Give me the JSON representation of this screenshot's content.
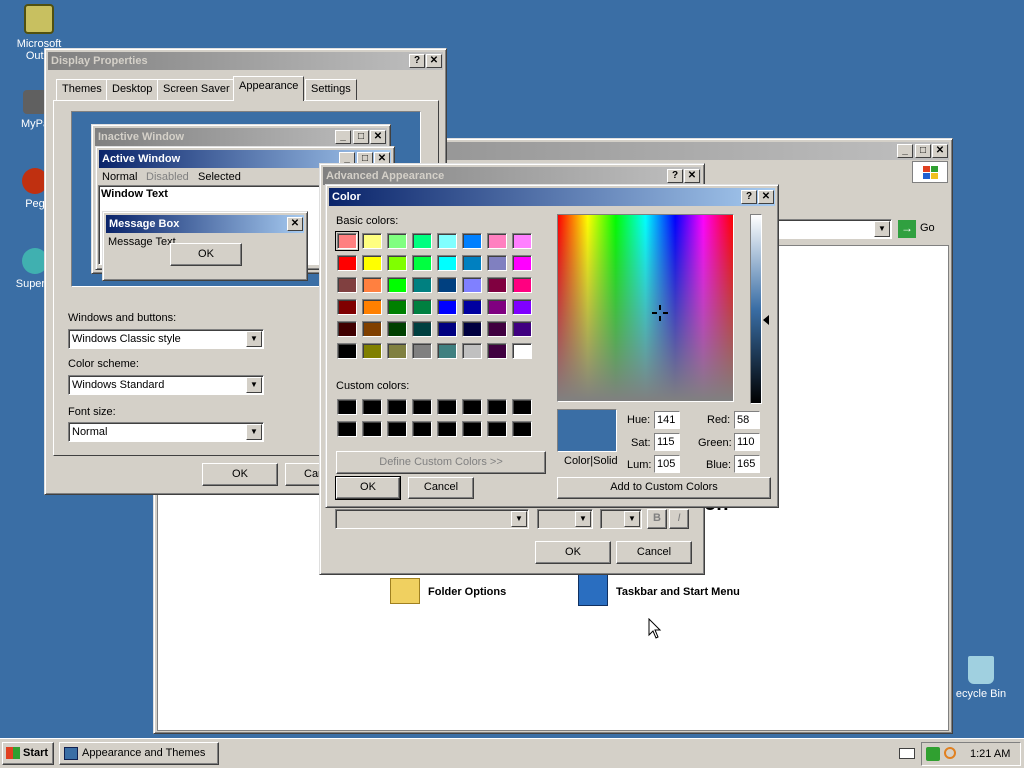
{
  "desktop": {
    "icons": [
      {
        "label": "Microsoft Outlo",
        "icon": "outlook-icon"
      },
      {
        "label": "MyPa",
        "icon": "my-pictures-icon"
      },
      {
        "label": "Peg",
        "icon": "app-icon"
      },
      {
        "label": "Superm",
        "icon": "app-icon"
      },
      {
        "label": "ecycle Bin",
        "icon": "recycle-bin-icon"
      }
    ]
  },
  "explorer": {
    "go_label": "Go",
    "folder_options": "Folder Options",
    "taskbar_start_menu": "Taskbar and Start Menu",
    "partial_heading": "on"
  },
  "display_properties": {
    "title": "Display Properties",
    "tabs": [
      "Themes",
      "Desktop",
      "Screen Saver",
      "Appearance",
      "Settings"
    ],
    "preview": {
      "inactive_title": "Inactive Window",
      "active_title": "Active Window",
      "menu": [
        "Normal",
        "Disabled",
        "Selected"
      ],
      "window_text": "Window Text",
      "msgbox_title": "Message Box",
      "msgbox_text": "Message Text",
      "msgbox_ok": "OK"
    },
    "windows_buttons_label": "Windows and buttons:",
    "windows_buttons_value": "Windows Classic style",
    "color_scheme_label": "Color scheme:",
    "color_scheme_value": "Windows Standard",
    "font_size_label": "Font size:",
    "font_size_value": "Normal",
    "ok": "OK",
    "cancel": "Car"
  },
  "advanced": {
    "title": "Advanced Appearance",
    "ok": "OK",
    "cancel": "Cancel",
    "bold": "B",
    "italic": "I"
  },
  "color_dialog": {
    "title": "Color",
    "basic_label": "Basic colors:",
    "basic_colors": [
      "#ff8080",
      "#ffff80",
      "#80ff80",
      "#00ff80",
      "#80ffff",
      "#0080ff",
      "#ff80c0",
      "#ff80ff",
      "#ff0000",
      "#ffff00",
      "#80ff00",
      "#00ff40",
      "#00ffff",
      "#0080c0",
      "#8080c0",
      "#ff00ff",
      "#804040",
      "#ff8040",
      "#00ff00",
      "#008080",
      "#004080",
      "#8080ff",
      "#800040",
      "#ff0080",
      "#800000",
      "#ff8000",
      "#008000",
      "#008040",
      "#0000ff",
      "#0000a0",
      "#800080",
      "#8000ff",
      "#400000",
      "#804000",
      "#004000",
      "#004040",
      "#000080",
      "#000040",
      "#400040",
      "#400080",
      "#000000",
      "#808000",
      "#808040",
      "#808080",
      "#408080",
      "#c0c0c0",
      "#400040",
      "#ffffff"
    ],
    "custom_label": "Custom colors:",
    "custom_colors": [
      "#000000",
      "#000000",
      "#000000",
      "#000000",
      "#000000",
      "#000000",
      "#000000",
      "#000000",
      "#000000",
      "#000000",
      "#000000",
      "#000000",
      "#000000",
      "#000000",
      "#000000",
      "#000000"
    ],
    "define_custom": "Define Custom Colors >>",
    "ok": "OK",
    "cancel": "Cancel",
    "color_solid": "Color|Solid",
    "selected_color": "#3a6ea5",
    "hue_label": "Hue:",
    "hue": "141",
    "sat_label": "Sat:",
    "sat": "115",
    "lum_label": "Lum:",
    "lum": "105",
    "red_label": "Red:",
    "red": "58",
    "green_label": "Green:",
    "green": "110",
    "blue_label": "Blue:",
    "blue": "165",
    "add_custom": "Add to Custom Colors"
  },
  "taskbar": {
    "start": "Start",
    "task": "Appearance and Themes",
    "clock": "1:21 AM"
  }
}
